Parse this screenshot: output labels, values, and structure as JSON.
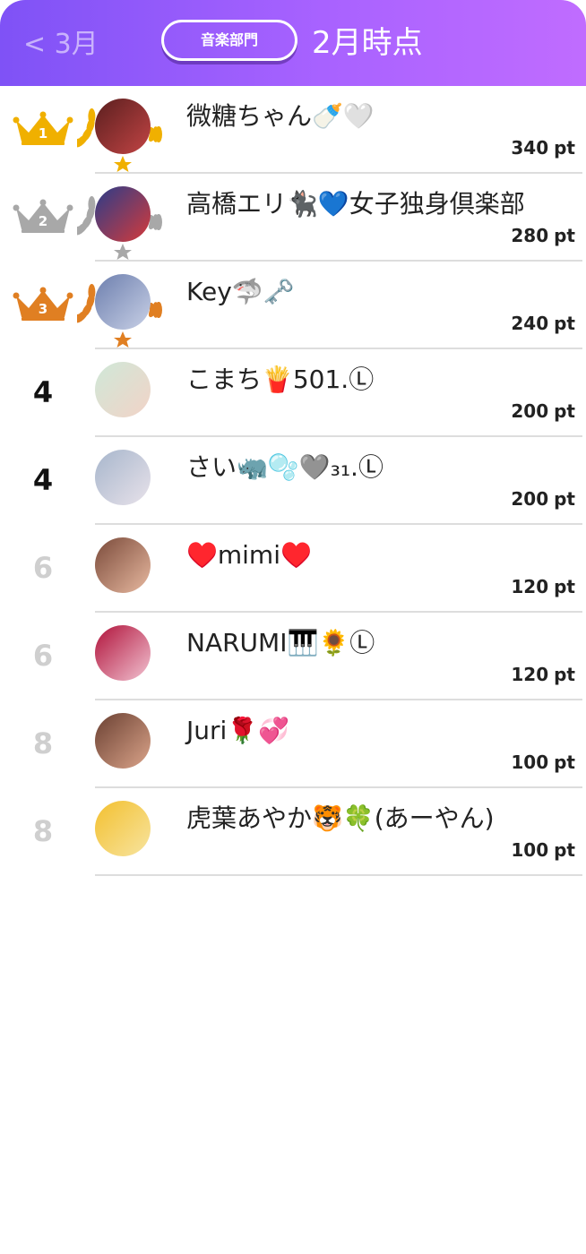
{
  "header": {
    "back_label": "< 3月",
    "category_label": "音楽部門",
    "period_label": "2月時点"
  },
  "colors": {
    "header_gradient_start": "#7f52f6",
    "header_gradient_end": "#c06cff",
    "gold": "#f0b000",
    "silver": "#a8a8a8",
    "bronze": "#e07f22",
    "divider": "#dddddd",
    "dim_rank": "#cfcfcf"
  },
  "rankings": [
    {
      "rank": "1",
      "medal": "gold",
      "name": "微糖ちゃん🍼🤍",
      "points": "340",
      "unit": "pt",
      "avatar_colors": [
        "#5a1f1f",
        "#c24444"
      ]
    },
    {
      "rank": "2",
      "medal": "silver",
      "name": "高橋エリ🐈‍⬛💙女子独身倶楽部",
      "points": "280",
      "unit": "pt",
      "avatar_colors": [
        "#2a3d8a",
        "#d63a3a"
      ]
    },
    {
      "rank": "3",
      "medal": "bronze",
      "name": "Key🦈🗝️",
      "points": "240",
      "unit": "pt",
      "avatar_colors": [
        "#6d7fae",
        "#c8d0e6"
      ]
    },
    {
      "rank": "4",
      "medal": "none",
      "name": "こまち🍟501.Ⓛ",
      "points": "200",
      "unit": "pt",
      "avatar_colors": [
        "#cfe8d8",
        "#f2d3c7"
      ]
    },
    {
      "rank": "4",
      "medal": "none",
      "name": "さい🦏🫧🩶₃₁.Ⓛ",
      "points": "200",
      "unit": "pt",
      "avatar_colors": [
        "#a7b6cc",
        "#e8e2ea"
      ]
    },
    {
      "rank": "6",
      "medal": "none",
      "name": "♥️mimi♥️",
      "points": "120",
      "unit": "pt",
      "avatar_colors": [
        "#7a4a3a",
        "#e8b9a0"
      ]
    },
    {
      "rank": "6",
      "medal": "none",
      "name": "NARUMI🎹🌻Ⓛ",
      "points": "120",
      "unit": "pt",
      "avatar_colors": [
        "#b0123a",
        "#f2c3d2"
      ]
    },
    {
      "rank": "8",
      "medal": "none",
      "name": "Juri🌹💞",
      "points": "100",
      "unit": "pt",
      "avatar_colors": [
        "#6a4032",
        "#dba48a"
      ]
    },
    {
      "rank": "8",
      "medal": "none",
      "name": "虎葉あやか🐯🍀(あーやん)",
      "points": "100",
      "unit": "pt",
      "avatar_colors": [
        "#f3c02f",
        "#f7e4a0"
      ]
    }
  ]
}
